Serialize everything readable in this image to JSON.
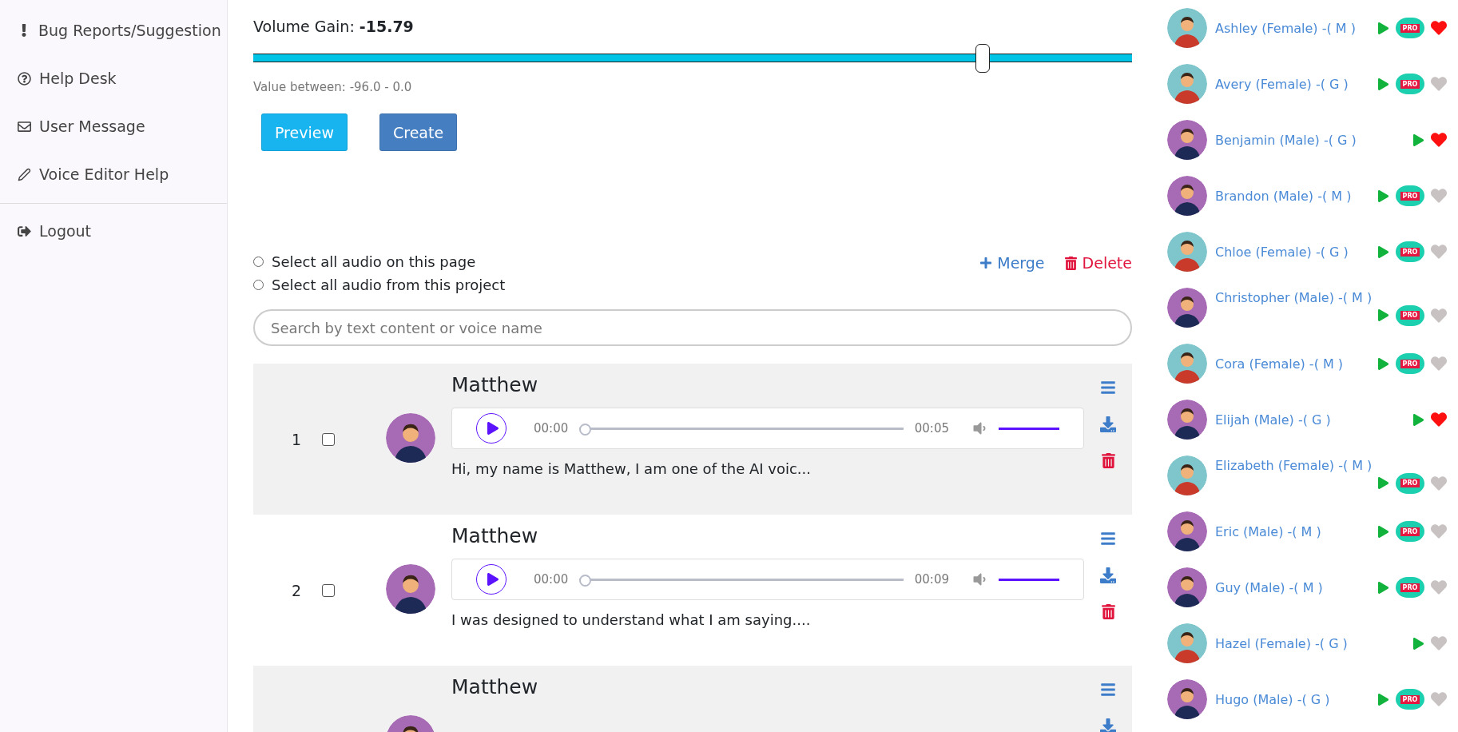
{
  "sidebar": {
    "items": [
      {
        "kind": "bug",
        "label": "Bug Reports/Suggestion"
      },
      {
        "kind": "help",
        "label": "Help Desk"
      },
      {
        "kind": "message",
        "label": "User Message"
      },
      {
        "kind": "editor",
        "label": "Voice Editor Help"
      },
      {
        "kind": "logout",
        "label": "Logout"
      }
    ]
  },
  "volume": {
    "label": "Volume Gain:",
    "value": "-15.79",
    "level": 0.83,
    "hint": "Value between: -96.0 - 0.0"
  },
  "buttons": [
    {
      "kind": "preview",
      "label": "Preview"
    },
    {
      "kind": "create",
      "label": "Create"
    }
  ],
  "select_options": [
    {
      "label": "Select all audio on this page",
      "selected": false
    },
    {
      "label": "Select all audio from this project",
      "selected": false
    }
  ],
  "actions": [
    {
      "kind": "merge",
      "label": "Merge"
    },
    {
      "kind": "delete",
      "label": "Delete"
    }
  ],
  "search": {
    "placeholder": "Search by text content or voice name"
  },
  "audio_rows": [
    {
      "index": "1",
      "checked": false,
      "kind": "male",
      "voice": "Matthew",
      "current": "00:00",
      "duration": "00:05",
      "text": "Hi, my name is Matthew, I am one of the AI voic..."
    },
    {
      "index": "2",
      "checked": false,
      "kind": "male",
      "voice": "Matthew",
      "current": "00:00",
      "duration": "00:09",
      "text": "I was designed to understand what I am saying...."
    },
    {
      "kind": "male",
      "voice": "Matthew"
    }
  ],
  "voices": [
    {
      "name": "Ashley (Female) -( M )",
      "kind": "female",
      "badge": "PRO",
      "favorite": true
    },
    {
      "name": "Avery (Female) -( G )",
      "kind": "female",
      "badge": "PRO",
      "favorite": false
    },
    {
      "name": "Benjamin (Male) -( G )",
      "kind": "male",
      "favorite": true
    },
    {
      "name": "Brandon (Male) -( M )",
      "kind": "male",
      "badge": "PRO",
      "favorite": false
    },
    {
      "name": "Chloe (Female) -( G )",
      "kind": "female",
      "badge": "PRO",
      "favorite": false
    },
    {
      "name": "Christopher (Male) -( M )",
      "kind": "male",
      "badge": "PRO",
      "favorite": false
    },
    {
      "name": "Cora (Female) -( M )",
      "kind": "female",
      "badge": "PRO",
      "favorite": false
    },
    {
      "name": "Elijah (Male) -( G )",
      "kind": "male",
      "favorite": true
    },
    {
      "name": "Elizabeth (Female) -( M )",
      "kind": "female",
      "badge": "PRO",
      "favorite": false
    },
    {
      "name": "Eric (Male) -( M )",
      "kind": "male",
      "badge": "PRO",
      "favorite": false
    },
    {
      "name": "Guy (Male) -( M )",
      "kind": "male",
      "badge": "PRO",
      "favorite": false
    },
    {
      "name": "Hazel (Female) -( G )",
      "kind": "female",
      "favorite": false
    },
    {
      "name": "Hugo (Male) -( G )",
      "kind": "male",
      "badge": "PRO",
      "favorite": false
    }
  ]
}
